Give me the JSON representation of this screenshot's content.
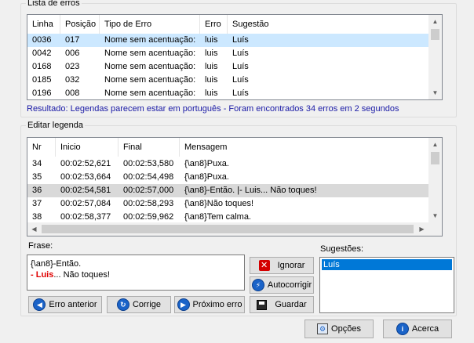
{
  "errors_group": {
    "title": "Lista de erros",
    "columns": [
      "Linha",
      "Posição",
      "Tipo de Erro",
      "Erro",
      "Sugestão"
    ],
    "rows": [
      [
        "0036",
        "017",
        "Nome sem acentuação:",
        "luis",
        "Luís"
      ],
      [
        "0042",
        "006",
        "Nome sem acentuação:",
        "luis",
        "Luís"
      ],
      [
        "0168",
        "023",
        "Nome sem acentuação:",
        "luis",
        "Luís"
      ],
      [
        "0185",
        "032",
        "Nome sem acentuação:",
        "luis",
        "Luís"
      ],
      [
        "0196",
        "008",
        "Nome sem acentuação:",
        "luis",
        "Luís"
      ]
    ],
    "result": "Resultado: Legendas parecem estar em português - Foram encontrados 34 erros em 2 segundos"
  },
  "edit_group": {
    "title": "Editar legenda",
    "columns": [
      "Nr",
      "Inicio",
      "Final",
      "Mensagem"
    ],
    "rows": [
      [
        "34",
        "00:02:52,621",
        "00:02:53,580",
        "{\\an8}Puxa."
      ],
      [
        "35",
        "00:02:53,664",
        "00:02:54,498",
        "{\\an8}Puxa."
      ],
      [
        "36",
        "00:02:54,581",
        "00:02:57,000",
        "{\\an8}-Então. |- Luis... Não toques!"
      ],
      [
        "37",
        "00:02:57,084",
        "00:02:58,293",
        "{\\an8}Não toques!"
      ],
      [
        "38",
        "00:02:58,377",
        "00:02:59,962",
        "{\\an8}Tem calma."
      ]
    ],
    "frase_label": "Frase:",
    "frase_line1": "{\\an8}-Então.",
    "frase_line2_prefix": "- ",
    "frase_line2_error": "Luis",
    "frase_line2_suffix": "... Não toques!",
    "sugestoes_label": "Sugestões:",
    "sugestoes": [
      "Luís"
    ],
    "btn_ignorar": "Ignorar",
    "btn_autocorrigir": "Autocorrigir",
    "btn_guardar": "Guardar",
    "btn_erro_anterior": "Erro anterior",
    "btn_corrige": "Corrige",
    "btn_proximo": "Próximo erro"
  },
  "footer": {
    "btn_opcoes": "Opções",
    "btn_acerca": "Acerca"
  },
  "colors": {
    "selected_blue": "#cce8ff",
    "selected_gray": "#d9d9d9",
    "suggestion_highlight": "#0078d7",
    "error_red": "#e00000",
    "result_blue": "#1a1aa6"
  }
}
